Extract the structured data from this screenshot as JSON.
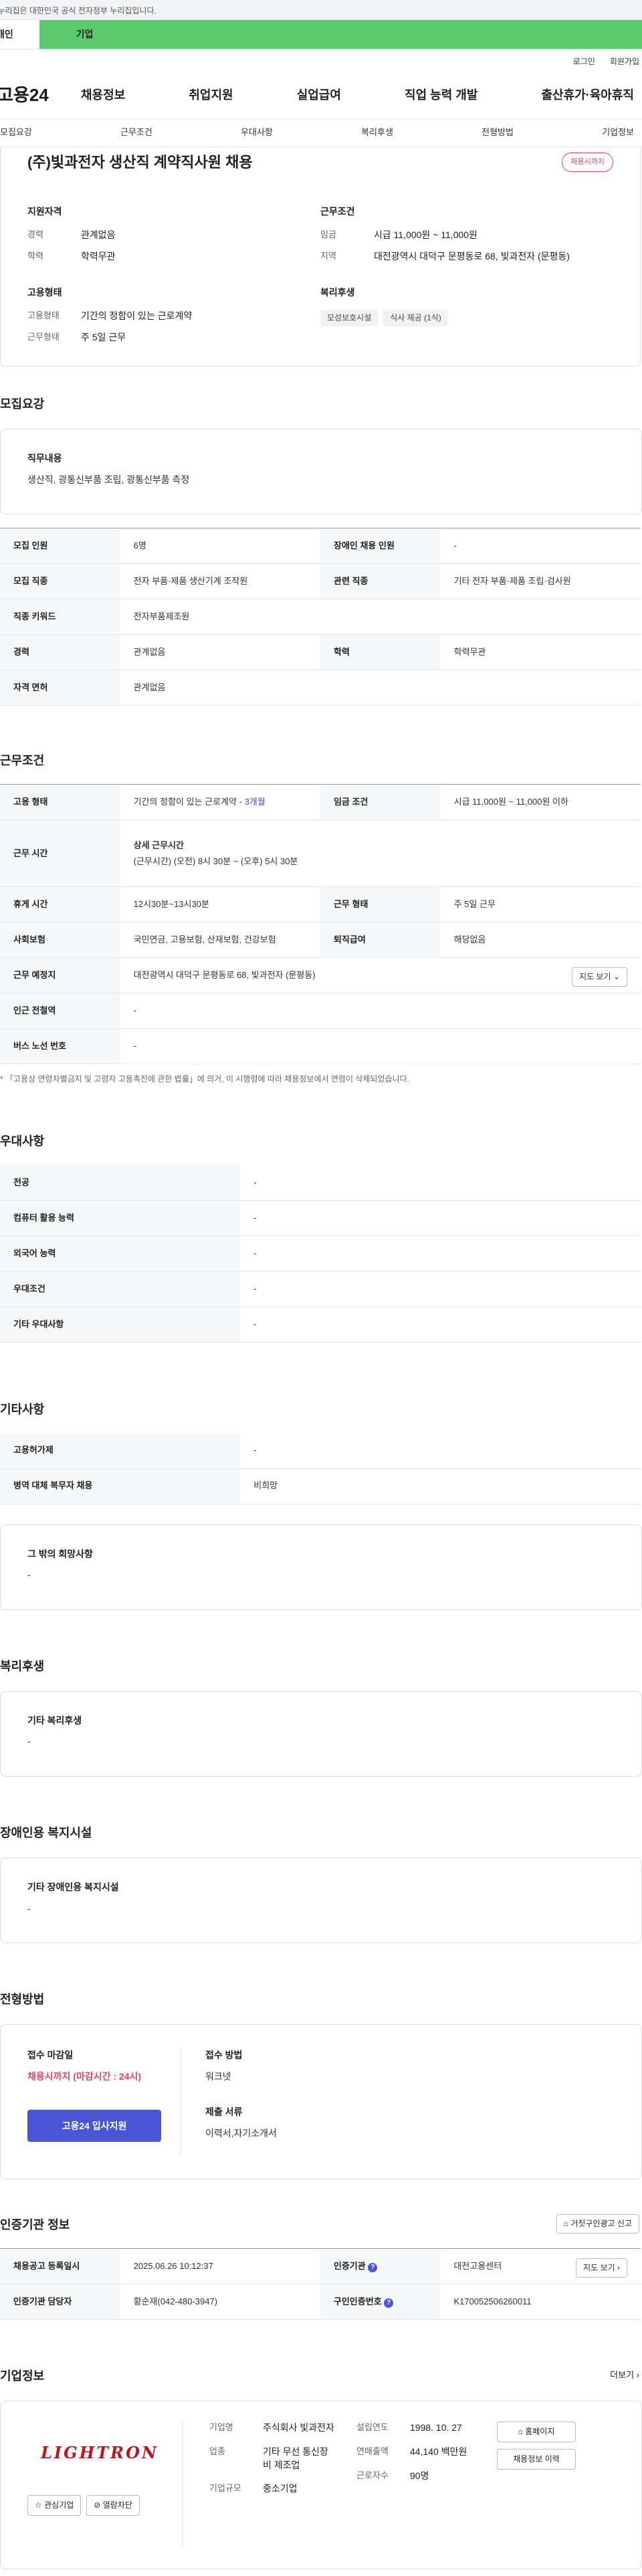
{
  "govbar": {
    "text": "이 누리집은 대한민국 공식 전자정부 누리집입니다."
  },
  "topTabs": {
    "personal": "개인",
    "enterprise": "기업"
  },
  "util": {
    "login": "로그인",
    "join": "회원가입"
  },
  "gnb": {
    "logo": "고용24",
    "menu": [
      "채용정보",
      "취업지원",
      "실업급여",
      "직업 능력 개발",
      "출산휴가·육아휴직"
    ]
  },
  "subnav": [
    "모집요강",
    "근무조건",
    "우대사항",
    "복리후생",
    "전형방법",
    "기업정보"
  ],
  "job": {
    "title": "(주)빛과전자 생산직 계약직사원 채용",
    "badge": "채용시까지",
    "qual": {
      "title": "지원자격",
      "career_k": "경력",
      "career_v": "관계없음",
      "edu_k": "학력",
      "edu_v": "학력무관"
    },
    "cond": {
      "title": "근무조건",
      "wage_k": "임금",
      "wage_v": "시급 11,000원 ~ 11,000원",
      "loc_k": "지역",
      "loc_v": "대전광역시 대덕구 문평동로 68, 빛과전자 (문평동)"
    },
    "emp": {
      "title": "고용형태",
      "type_k": "고용형태",
      "type_v": "기간의 정함이 있는 근로계약",
      "days_k": "근무형태",
      "days_v": "주 5일 근무"
    },
    "welfare": {
      "title": "복리후생",
      "tags": [
        "모성보호시설",
        "식사 제공 (1식)"
      ]
    }
  },
  "recruit": {
    "title": "모집요강",
    "duty_t": "직무내용",
    "duty_v": "생산직, 광통신부품 조립, 광통신부품 측정",
    "rows": [
      [
        "모집 인원",
        "6명",
        "장애인 채용 인원",
        "-"
      ],
      [
        "모집 직종",
        "전자 부품·제품 생산기계 조작원",
        "관련 직종",
        "기타 전자 부품·제품 조립·검사원"
      ],
      [
        "직종 키워드",
        "전자부품제조원"
      ],
      [
        "경력",
        "관계없음",
        "학력",
        "학력무관"
      ],
      [
        "자격 면허",
        "관계없음"
      ]
    ]
  },
  "work": {
    "title": "근무조건",
    "r1": [
      "고용 형태",
      "기간의 정함이 있는 근로계약 - ",
      "3개월",
      "임금 조건",
      "시급 11,000원 ~ 11,000원 이하"
    ],
    "r2": [
      "근무 시간",
      "상세 근무시간",
      "(근무시간) (오전) 8시 30분 ~ (오후) 5시 30분"
    ],
    "r3": [
      "휴게 시간",
      "12시30분~13시30분",
      "근무 형태",
      "주 5일 근무"
    ],
    "r4": [
      "사회보험",
      "국민연금, 고용보험, 산재보험, 건강보험",
      "퇴직급여",
      "해당없음"
    ],
    "r5": [
      "근무 예정지",
      "대전광역시 대덕구 문평동로 68, 빛과전자 (문평동)",
      "지도 보기"
    ],
    "r6": [
      "인근 전철역",
      "-"
    ],
    "r7": [
      "버스 노선 번호",
      "-"
    ],
    "note": "* 「고용상 연령차별금지 및 고령자 고용촉진에 관한 법률」에 의거, 이 시행령에 따라 채용정보에서 연령이 삭제되었습니다."
  },
  "pref": {
    "title": "우대사항",
    "rows": [
      [
        "전공",
        "-"
      ],
      [
        "컴퓨터 활용 능력",
        "-"
      ],
      [
        "외국어 능력",
        "-"
      ],
      [
        "우대조건",
        "-"
      ],
      [
        "기타 우대사항",
        "-"
      ]
    ]
  },
  "etc": {
    "title": "기타사항",
    "rows": [
      [
        "고용허가제",
        "-"
      ],
      [
        "병역 대체 복무자 채용",
        "비희망"
      ]
    ],
    "box_t": "그 밖의 희망사항",
    "box_v": "-"
  },
  "benefit": {
    "title": "복리후생",
    "box_t": "기타 복리후생",
    "box_v": "-"
  },
  "disabled": {
    "title": "장애인용 복지시설",
    "box_t": "기타 장애인용 복지시설",
    "box_v": "-"
  },
  "selection": {
    "title": "전형방법",
    "deadline_t": "접수 마감일",
    "deadline_v": "채용시까지 (마감시간 : 24시)",
    "apply_btn": "고용24 입사지원",
    "method_t": "접수 방법",
    "method_v": "워크넷",
    "docs_t": "제출 서류",
    "docs_v": "이력서,자기소개서"
  },
  "cert": {
    "title": "인증기관 정보",
    "report_btn": "거짓구인광고 신고",
    "r1": [
      "채용공고 등록일시",
      "2025.06.26 10:12:37",
      "인증기관",
      "대전고용센터",
      "지도 보기"
    ],
    "r2": [
      "인증기관 담당자",
      "황순재(042-480-3947)",
      "구인인증번호",
      "K170052506260011"
    ]
  },
  "company": {
    "title": "기업정보",
    "more": "더보기",
    "logo_text": "LIGHTRON",
    "interest_btn": "관심기업",
    "block_btn": "열람차단",
    "name_k": "기업명",
    "name_v": "주식회사 빛과전자",
    "ind_k": "업종",
    "ind_v": "기타 무선 통신장비 제조업",
    "size_k": "기업규모",
    "size_v": "중소기업",
    "founded_k": "설립연도",
    "founded_v": "1998. 10. 27",
    "sales_k": "연매출액",
    "sales_v": "44,140 백만원",
    "staff_k": "근로자수",
    "staff_v": "90명",
    "home_btn": "홈페이지",
    "jobs_btn": "채용정보 이력"
  }
}
